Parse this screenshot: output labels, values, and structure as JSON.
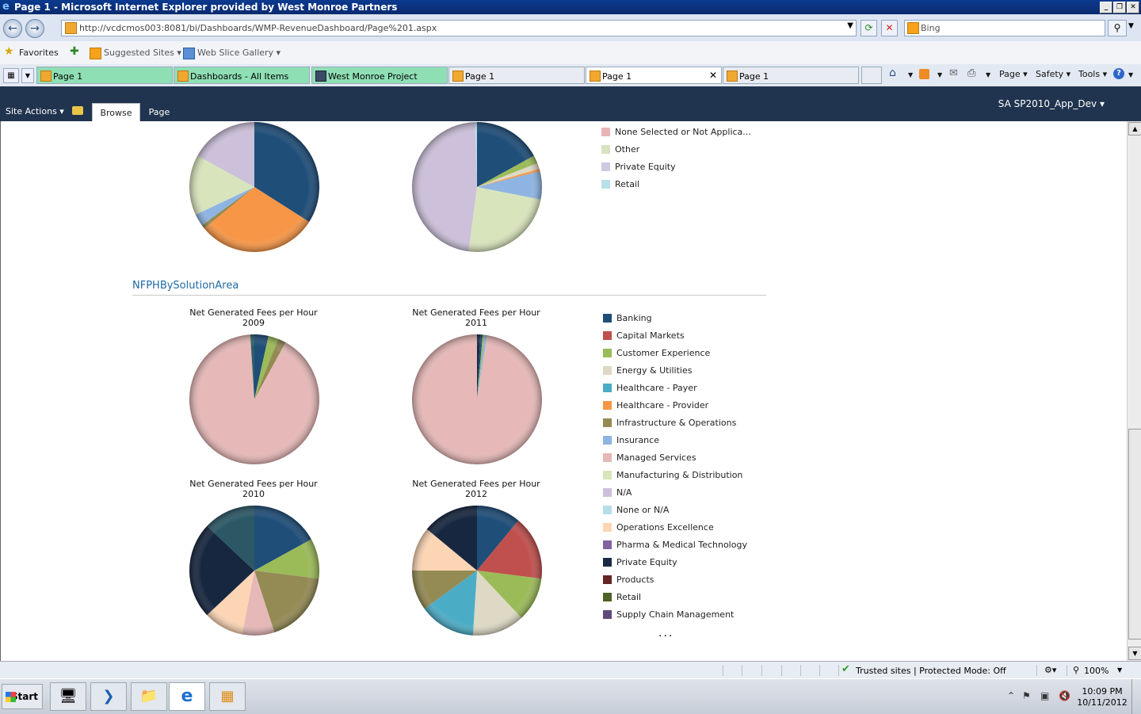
{
  "window": {
    "title": "Page 1 - Microsoft Internet Explorer provided by West Monroe Partners"
  },
  "address_bar": {
    "url": "http://vcdcmos003:8081/bi/Dashboards/WMP-RevenueDashboard/Page%201.aspx",
    "search_placeholder": "Bing"
  },
  "favorites_bar": {
    "favorites_label": "Favorites",
    "suggested_sites": "Suggested Sites ▾",
    "web_slice_gallery": "Web Slice Gallery ▾"
  },
  "tabs": [
    {
      "label": "Page 1",
      "style": "green"
    },
    {
      "label": "Dashboards - All Items",
      "style": "green"
    },
    {
      "label": "West Monroe Project",
      "style": "green"
    },
    {
      "label": "Page 1",
      "style": "plain"
    },
    {
      "label": "Page 1",
      "style": "active"
    },
    {
      "label": "Page 1",
      "style": "plain"
    }
  ],
  "command_bar": {
    "page": "Page ▾",
    "safety": "Safety ▾",
    "tools": "Tools ▾"
  },
  "ribbon": {
    "site_actions": "Site Actions ▾",
    "tab_browse": "Browse",
    "tab_page": "Page",
    "user": "SA SP2010_App_Dev ▾"
  },
  "top_legend": [
    {
      "label": "None Selected or Not Applica...",
      "color": "#e8b4b6"
    },
    {
      "label": "Other",
      "color": "#d6e3c0"
    },
    {
      "label": "Private Equity",
      "color": "#d0c8e0"
    },
    {
      "label": "Retail",
      "color": "#b8e0e8"
    }
  ],
  "section": {
    "title": "NFPHBySolutionArea"
  },
  "chart_data": [
    {
      "type": "pie",
      "title": "",
      "partial": true,
      "slices": [
        {
          "name": "dark blue",
          "value": 34,
          "color": "#1f4e79"
        },
        {
          "name": "orange",
          "value": 30,
          "color": "#f79646"
        },
        {
          "name": "olive",
          "value": 1,
          "color": "#948a54"
        },
        {
          "name": "light blue",
          "value": 3,
          "color": "#8db4e2"
        },
        {
          "name": "light green",
          "value": 15,
          "color": "#d8e4bc"
        },
        {
          "name": "lavender",
          "value": 17,
          "color": "#ccc0da"
        }
      ]
    },
    {
      "type": "pie",
      "title": "",
      "partial": true,
      "slices": [
        {
          "name": "dark blue",
          "value": 17,
          "color": "#1f4e79"
        },
        {
          "name": "green",
          "value": 2,
          "color": "#9bbb59"
        },
        {
          "name": "pale",
          "value": 1.5,
          "color": "#ddd9c4"
        },
        {
          "name": "orange",
          "value": 0.6,
          "color": "#f79646"
        },
        {
          "name": "light blue",
          "value": 7,
          "color": "#8db4e2"
        },
        {
          "name": "light green",
          "value": 24,
          "color": "#d8e4bc"
        },
        {
          "name": "lavender",
          "value": 47.4,
          "color": "#ccc0da"
        },
        {
          "name": "pale cyan",
          "value": 0.5,
          "color": "#b7dee8"
        }
      ]
    },
    {
      "type": "pie",
      "title": "Net Generated Fees per Hour",
      "subtitle": "2009",
      "slices": [
        {
          "name": "Banking",
          "value": 3.5,
          "color": "#1f4e79"
        },
        {
          "name": "Customer Experience",
          "value": 2.5,
          "color": "#9bbb59"
        },
        {
          "name": "Infrastructure & Operations",
          "value": 2,
          "color": "#948a54"
        },
        {
          "name": "Managed Services",
          "value": 91,
          "color": "#e6b8b7"
        },
        {
          "name": "Healthcare - Payer",
          "value": 1,
          "color": "#2f5f66"
        }
      ]
    },
    {
      "type": "pie",
      "title": "Net Generated Fees per Hour",
      "subtitle": "2011",
      "slices": [
        {
          "name": "Private Equity",
          "value": 0.8,
          "color": "#1a2a44"
        },
        {
          "name": "Banking",
          "value": 0.6,
          "color": "#1f4e79"
        },
        {
          "name": "Customer Experience",
          "value": 0.5,
          "color": "#9bbb59"
        },
        {
          "name": "Insurance",
          "value": 0.6,
          "color": "#8db4e2"
        },
        {
          "name": "Managed Services",
          "value": 97.5,
          "color": "#e6b8b7"
        }
      ]
    },
    {
      "type": "pie",
      "title": "Net Generated Fees per Hour",
      "subtitle": "2010",
      "slices": [
        {
          "name": "Banking",
          "value": 17,
          "color": "#1f4e79"
        },
        {
          "name": "Customer Experience",
          "value": 10,
          "color": "#9bbb59"
        },
        {
          "name": "Infrastructure & Operations",
          "value": 18,
          "color": "#948a54"
        },
        {
          "name": "Managed Services",
          "value": 8,
          "color": "#e6b8b7"
        },
        {
          "name": "Operations Excellence",
          "value": 10,
          "color": "#fcd5b4"
        },
        {
          "name": "Private Equity",
          "value": 24,
          "color": "#172740"
        },
        {
          "name": "Healthcare - Payer",
          "value": 13,
          "color": "#2c5866"
        }
      ]
    },
    {
      "type": "pie",
      "title": "Net Generated Fees per Hour",
      "subtitle": "2012",
      "slices": [
        {
          "name": "Banking",
          "value": 11,
          "color": "#1f4e79"
        },
        {
          "name": "Capital Markets",
          "value": 16,
          "color": "#c0504d"
        },
        {
          "name": "Customer Experience",
          "value": 11,
          "color": "#9bbb59"
        },
        {
          "name": "Energy & Utilities",
          "value": 13,
          "color": "#ddd9c4"
        },
        {
          "name": "Healthcare - Payer",
          "value": 14,
          "color": "#4bacc6"
        },
        {
          "name": "Infrastructure & Operations",
          "value": 10,
          "color": "#948a54"
        },
        {
          "name": "Operations Excellence",
          "value": 11,
          "color": "#fcd5b4"
        },
        {
          "name": "Private Equity",
          "value": 14,
          "color": "#172740"
        }
      ]
    }
  ],
  "legend": [
    {
      "label": "Banking",
      "color": "#1f4e79"
    },
    {
      "label": "Capital Markets",
      "color": "#c0504d"
    },
    {
      "label": "Customer Experience",
      "color": "#9bbb59"
    },
    {
      "label": "Energy & Utilities",
      "color": "#ddd9c4"
    },
    {
      "label": "Healthcare - Payer",
      "color": "#4bacc6"
    },
    {
      "label": "Healthcare - Provider",
      "color": "#f79646"
    },
    {
      "label": "Infrastructure & Operations",
      "color": "#948a54"
    },
    {
      "label": "Insurance",
      "color": "#8db4e2"
    },
    {
      "label": "Managed Services",
      "color": "#e6b8b7"
    },
    {
      "label": "Manufacturing & Distribution",
      "color": "#d8e4bc"
    },
    {
      "label": "N/A",
      "color": "#ccc0da"
    },
    {
      "label": "None or N/A",
      "color": "#b7dee8"
    },
    {
      "label": "Operations Excellence",
      "color": "#fcd5b4"
    },
    {
      "label": "Pharma & Medical Technology",
      "color": "#8064a2"
    },
    {
      "label": "Private Equity",
      "color": "#1a2a44"
    },
    {
      "label": "Products",
      "color": "#632523"
    },
    {
      "label": "Retail",
      "color": "#4f6228"
    },
    {
      "label": "Supply Chain Management",
      "color": "#5f497a"
    }
  ],
  "legend_more": "...",
  "status_bar": {
    "zone": "Trusted sites | Protected Mode: Off",
    "zoom": "100%"
  },
  "taskbar": {
    "start": "Start",
    "time": "10:09 PM",
    "date": "10/11/2012"
  }
}
